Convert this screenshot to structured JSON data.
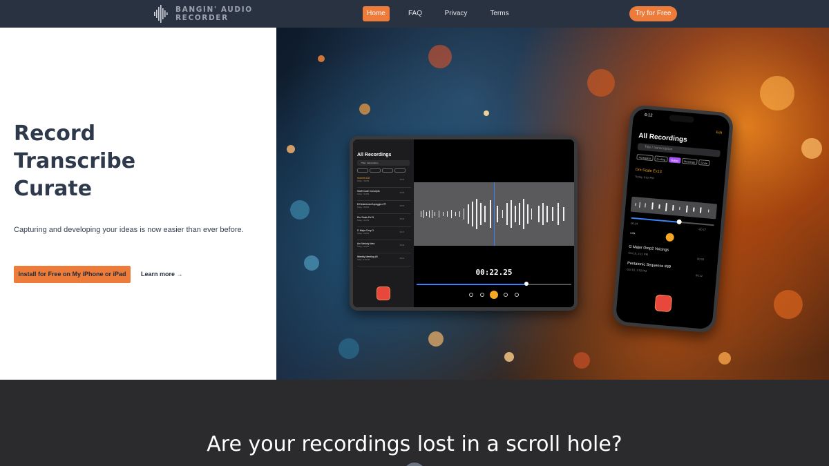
{
  "nav": {
    "logo_line1": "BANGIN' AUDIO",
    "logo_line2": "RECORDER",
    "links": [
      {
        "label": "Home",
        "active": true
      },
      {
        "label": "FAQ",
        "active": false
      },
      {
        "label": "Privacy",
        "active": false
      },
      {
        "label": "Terms",
        "active": false
      }
    ],
    "cta_label": "Try for Free",
    "accent_color": "#ed7b3a",
    "background_color": "#293241"
  },
  "hero": {
    "headline_words": [
      "Record",
      "Transcribe",
      "Curate"
    ],
    "subtitle": "Capturing and developing your ideas is now easier than ever before.",
    "primary_button": "Install for Free on My iPhone or iPad",
    "secondary_link": "Learn more →"
  },
  "tablet": {
    "title": "All Recordings",
    "search_placeholder": "Title / transcription",
    "time_display": "00:22.25",
    "items": [
      {
        "name": "Sonnet #18",
        "date": "Today, 7:30 PM",
        "time": "00:16"
      },
      {
        "name": "Swift Code Concepts",
        "date": "Today, 7:12 PM",
        "time": "00:06"
      },
      {
        "name": "B Diminished Arpeggio #77",
        "date": "Today, 1:53 PM",
        "time": "00:10"
      },
      {
        "name": "Dm Scale Ex13",
        "date": "Today, 1:44 PM",
        "time": "00:16"
      },
      {
        "name": "G Major Drop 2",
        "date": "Today, 1:38 PM",
        "time": "00:17"
      },
      {
        "name": "Am Melody Idea",
        "date": "Today, 1:22 PM",
        "time": "00:18"
      },
      {
        "name": "Weekly Meeting #5",
        "date": "Today, 11:06 AM",
        "time": "00:21"
      }
    ]
  },
  "phone": {
    "clock": "6:12",
    "title": "All Recordings",
    "edit_label": "Edit",
    "search_placeholder": "Title / transcription",
    "chips": [
      {
        "label": "Arpeggios",
        "on": false
      },
      {
        "label": "Coding",
        "on": false
      },
      {
        "label": "Guitar",
        "on": true
      },
      {
        "label": "Meetings",
        "on": false
      },
      {
        "label": "Scale",
        "on": false
      }
    ],
    "current_item": "Dm Scale Ex13",
    "current_item_date": "Today, 6:02 PM",
    "elapsed": "00:24",
    "remaining": "-00:17",
    "speed": "1.0x",
    "items": [
      {
        "name": "G Major Drop2 Voicings",
        "date": "Oct 10, 2:11 PM",
        "time": "00:03"
      },
      {
        "name": "Pentatonic Sequence #69",
        "date": "Oct 10, 1:52 PM",
        "time": "00:12"
      }
    ]
  },
  "section2": {
    "title": "Are your recordings lost in a scroll hole?"
  }
}
